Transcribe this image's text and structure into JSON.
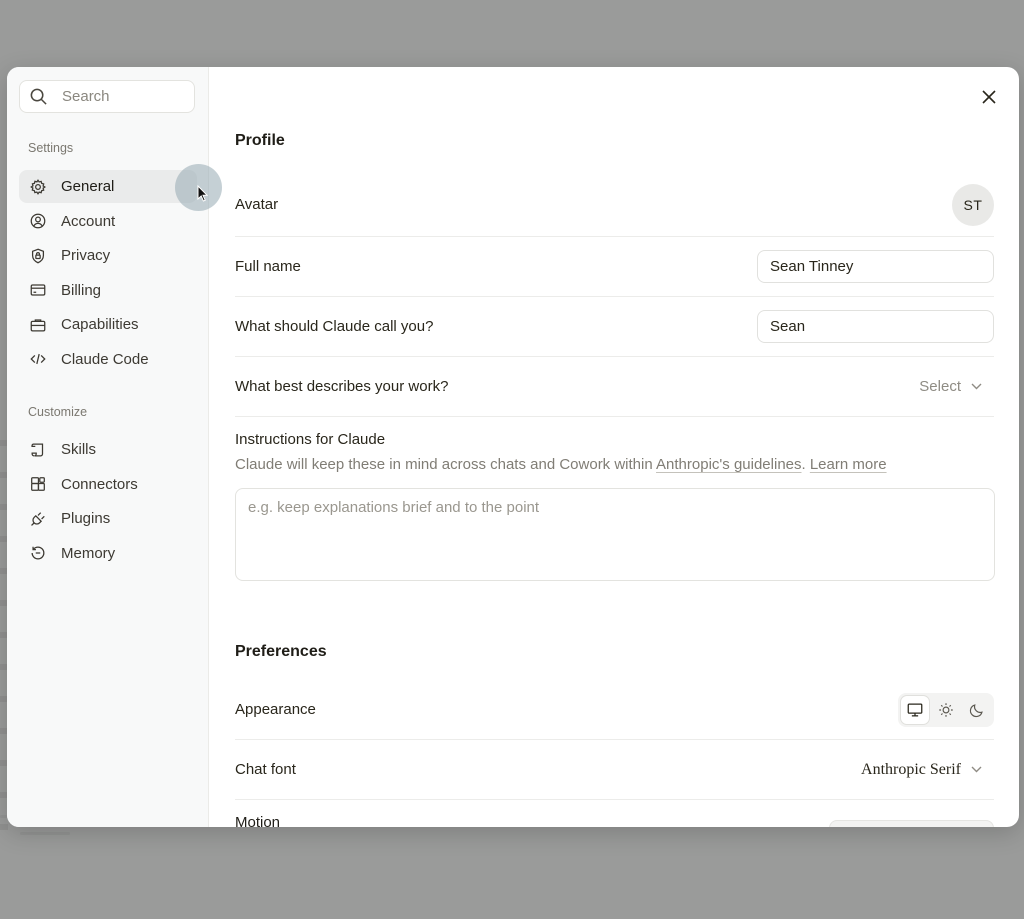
{
  "sidebar": {
    "search_placeholder": "Search",
    "settings_label": "Settings",
    "settings_items": [
      {
        "label": "General",
        "icon": "gear-icon",
        "active": true
      },
      {
        "label": "Account",
        "icon": "user-circle-icon"
      },
      {
        "label": "Privacy",
        "icon": "shield-lock-icon"
      },
      {
        "label": "Billing",
        "icon": "credit-card-icon"
      },
      {
        "label": "Capabilities",
        "icon": "briefcase-icon"
      },
      {
        "label": "Claude Code",
        "icon": "code-icon"
      }
    ],
    "customize_label": "Customize",
    "customize_items": [
      {
        "label": "Skills",
        "icon": "scroll-icon"
      },
      {
        "label": "Connectors",
        "icon": "blocks-icon"
      },
      {
        "label": "Plugins",
        "icon": "plug-icon"
      },
      {
        "label": "Memory",
        "icon": "history-icon"
      }
    ]
  },
  "profile": {
    "title": "Profile",
    "avatar_label": "Avatar",
    "avatar_initials": "ST",
    "full_name_label": "Full name",
    "full_name_value": "Sean Tinney",
    "nickname_label": "What should Claude call you?",
    "nickname_value": "Sean",
    "work_label": "What best describes your work?",
    "work_select": "Select",
    "instructions_title": "Instructions for Claude",
    "instructions_desc_prefix": "Claude will keep these in mind across chats and Cowork within ",
    "instructions_link": "Anthropic's guidelines",
    "instructions_sep": ". ",
    "instructions_learn_more": "Learn more",
    "instructions_placeholder": "e.g. keep explanations brief and to the point"
  },
  "preferences": {
    "title": "Preferences",
    "appearance_label": "Appearance",
    "appearance_options": [
      "monitor-icon",
      "sun-icon",
      "moon-icon"
    ],
    "appearance_selected": "monitor-icon",
    "chat_font_label": "Chat font",
    "chat_font_value": "Anthropic Serif",
    "motion_label": "Motion"
  }
}
